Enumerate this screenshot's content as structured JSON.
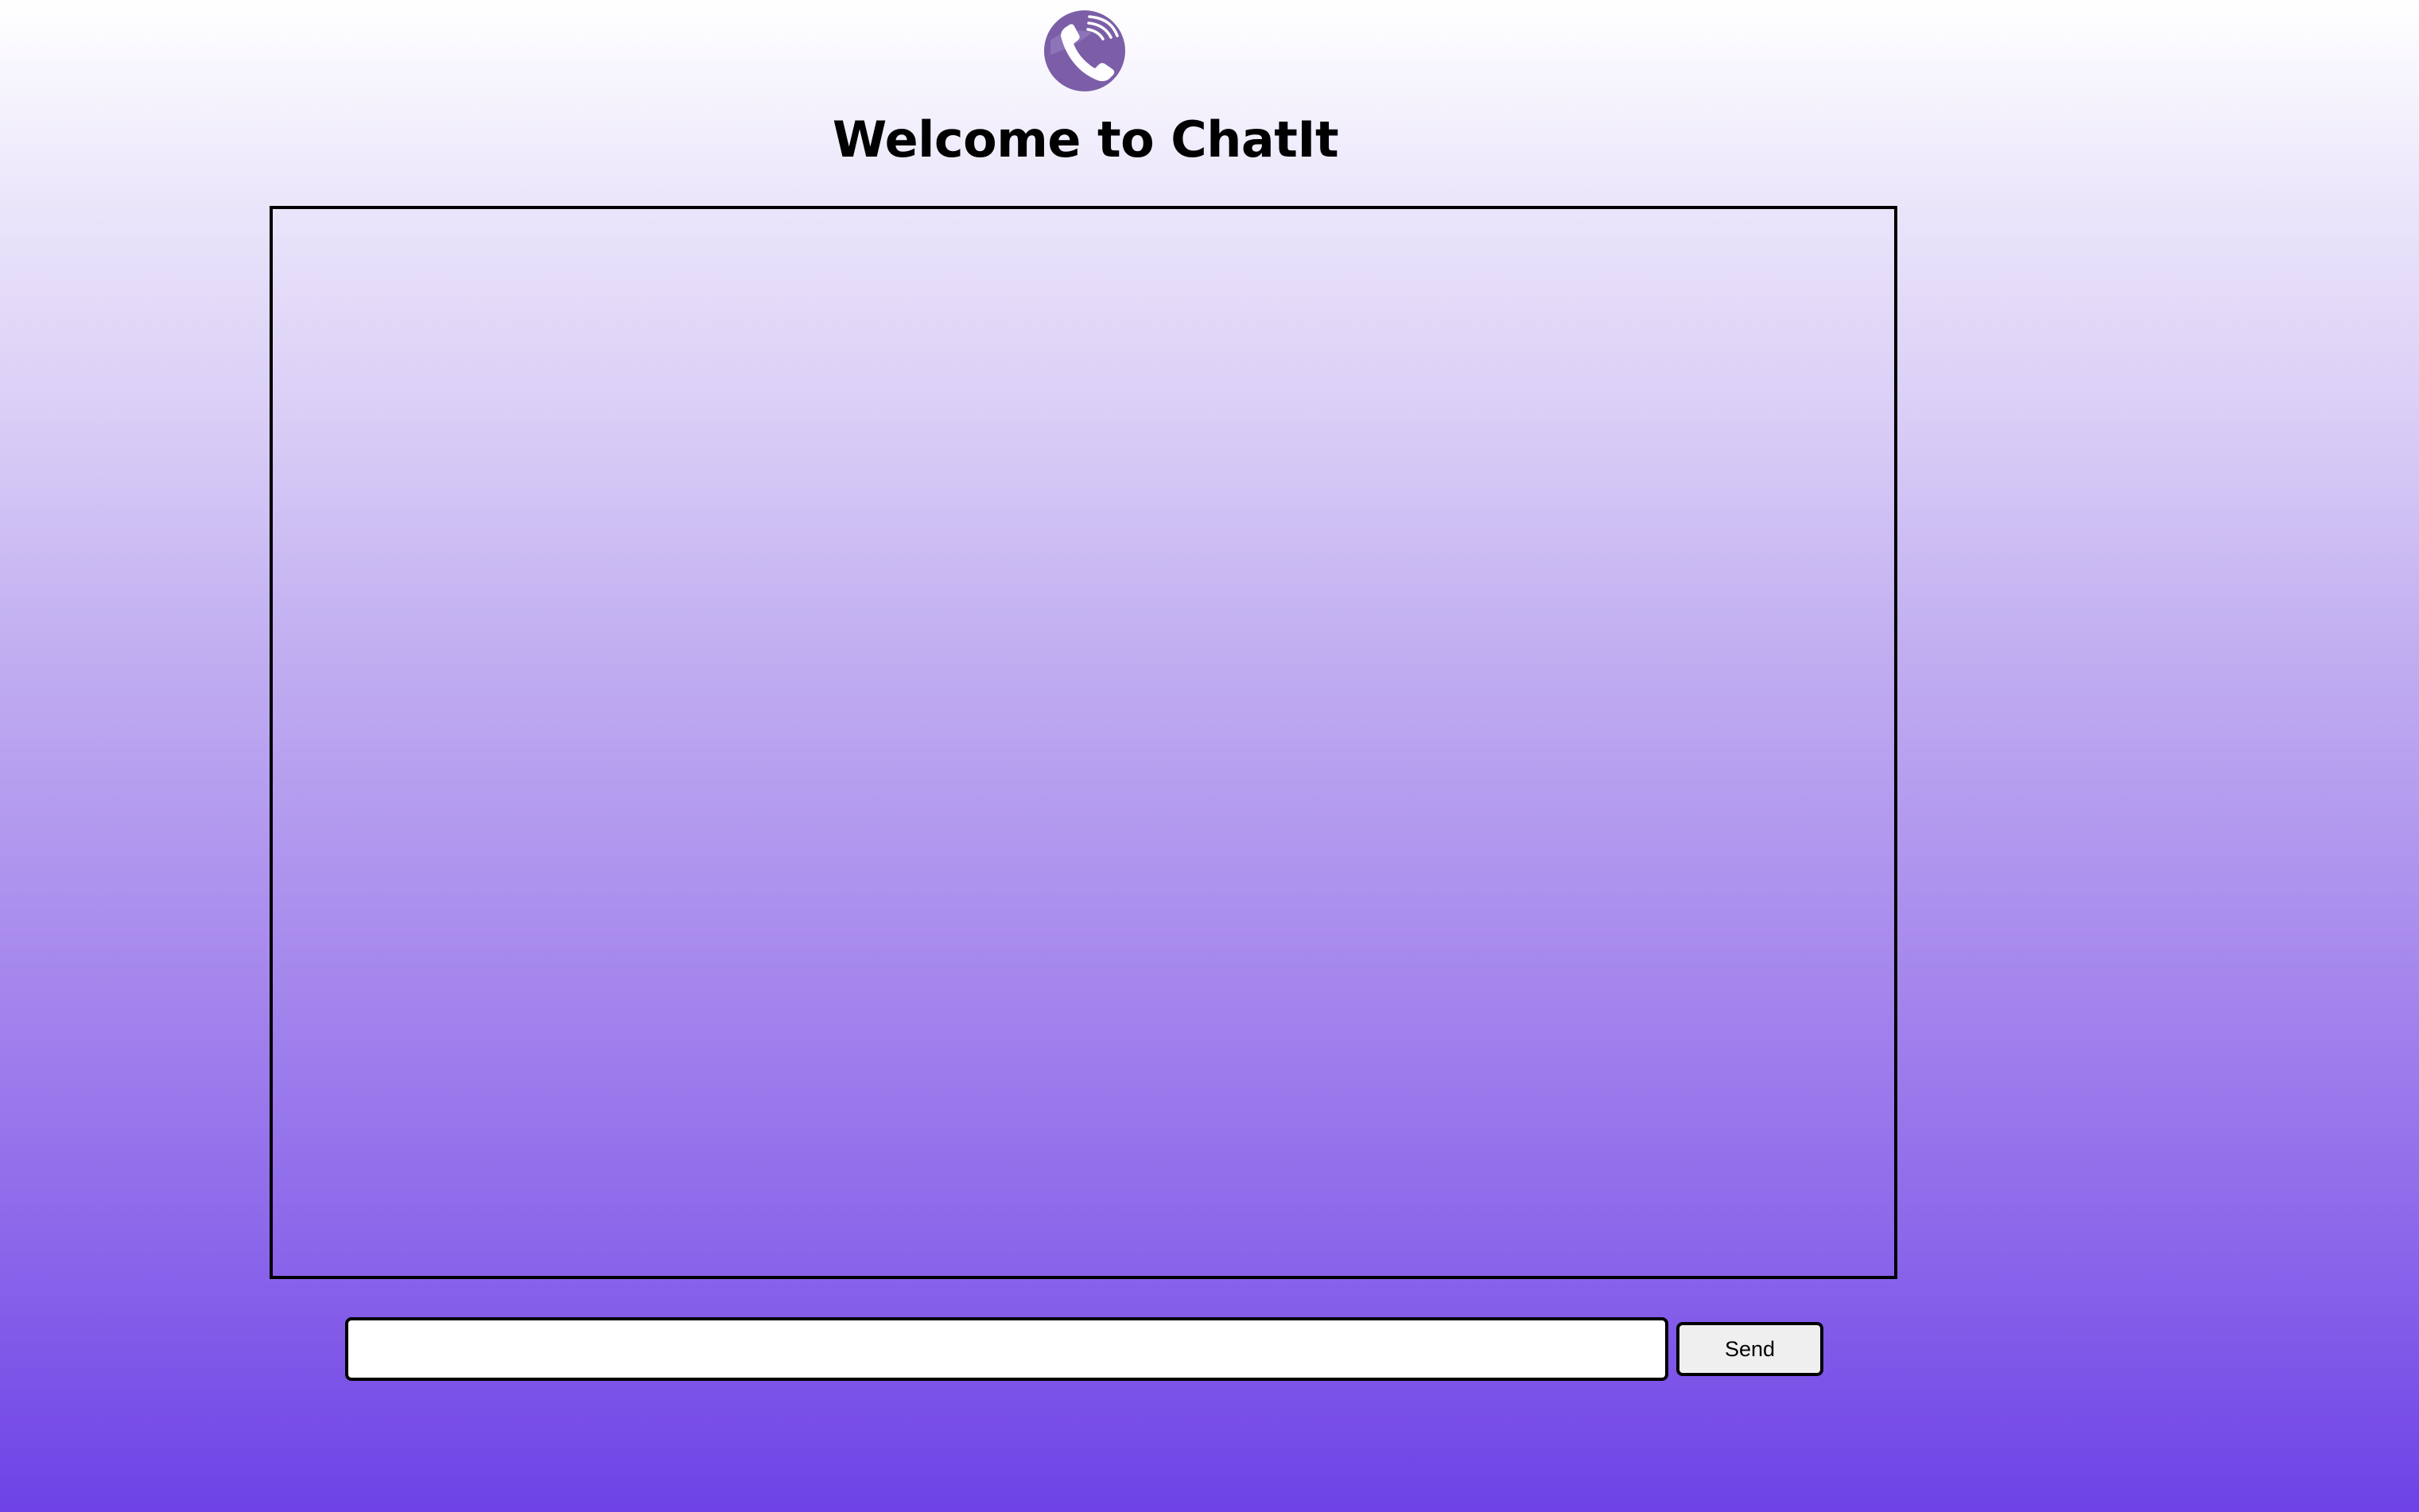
{
  "header": {
    "logo_icon": "phone-icon",
    "logo_color": "#7b5ea7",
    "title": "Welcome to ChatIt"
  },
  "chat": {
    "messages": []
  },
  "composer": {
    "input_value": "",
    "input_placeholder": "",
    "send_label": "Send"
  },
  "colors": {
    "gradient_top": "#ffffff",
    "gradient_bottom": "#6d42e6"
  }
}
